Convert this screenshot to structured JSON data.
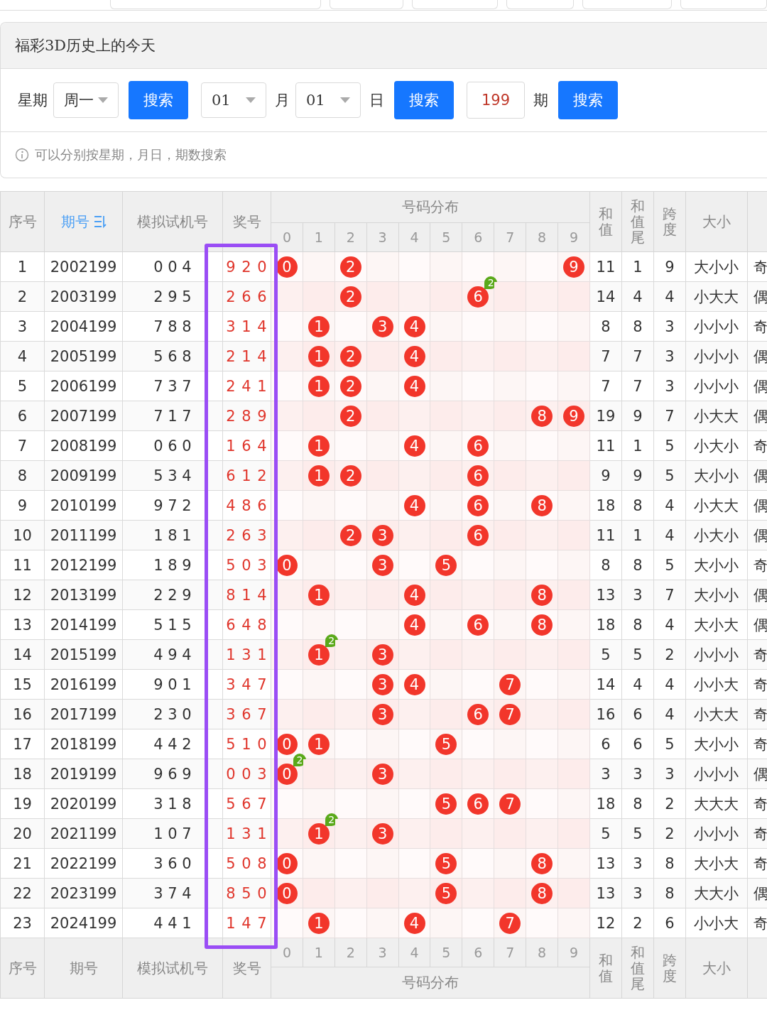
{
  "panel": {
    "title": "福彩3D历史上的今天",
    "controls": [
      {
        "kind": "label",
        "text": "星期"
      },
      {
        "kind": "select",
        "value": "周一"
      },
      {
        "kind": "button",
        "text": "搜索"
      },
      {
        "kind": "select",
        "value": "01"
      },
      {
        "kind": "label",
        "text": "月"
      },
      {
        "kind": "select",
        "value": "01"
      },
      {
        "kind": "label",
        "text": "日"
      },
      {
        "kind": "button",
        "text": "搜索"
      },
      {
        "kind": "input",
        "value": "199"
      },
      {
        "kind": "label",
        "text": "期"
      },
      {
        "kind": "button",
        "text": "搜索"
      }
    ],
    "hint": "可以分别按星期，月日，期数搜索"
  },
  "table": {
    "prize_highlight": true,
    "header": {
      "index": "序号",
      "issue": "期号",
      "issue_sorted": true,
      "trial": "模拟试机号",
      "prize": "奖号",
      "distribution": "号码分布",
      "digits": [
        "0",
        "1",
        "2",
        "3",
        "4",
        "5",
        "6",
        "7",
        "8",
        "9"
      ],
      "sum": "和值",
      "sum_tail": "和值尾",
      "span": "跨度",
      "size": "大小"
    },
    "rows": [
      {
        "index": "1",
        "issue": "2002199",
        "trial": "0 0 4",
        "prize": "9 2 0",
        "cells": [
          {
            "hit": true,
            "ball": "0"
          },
          {
            "hit": false
          },
          {
            "hit": true,
            "ball": "2"
          },
          {
            "hit": false
          },
          {
            "hit": false
          },
          {
            "hit": false
          },
          {
            "hit": false
          },
          {
            "hit": false
          },
          {
            "hit": false
          },
          {
            "hit": true,
            "ball": "9"
          }
        ],
        "sum": "11",
        "sum_tail": "1",
        "span": "9",
        "size": "大小小",
        "column_15": "奇"
      },
      {
        "index": "2",
        "issue": "2003199",
        "trial": "2 9 5",
        "prize": "2 6 6",
        "cells": [
          {
            "hit": false
          },
          {
            "hit": false
          },
          {
            "hit": true,
            "ball": "2"
          },
          {
            "hit": false
          },
          {
            "hit": false
          },
          {
            "hit": false
          },
          {
            "hit": true,
            "ball": "6",
            "repeat": "2"
          },
          {
            "hit": false
          },
          {
            "hit": false
          },
          {
            "hit": false
          }
        ],
        "sum": "14",
        "sum_tail": "4",
        "span": "4",
        "size": "小大大",
        "column_15": "偶"
      },
      {
        "index": "3",
        "issue": "2004199",
        "trial": "7 8 8",
        "prize": "3 1 4",
        "cells": [
          {
            "hit": false
          },
          {
            "hit": true,
            "ball": "1"
          },
          {
            "hit": false
          },
          {
            "hit": true,
            "ball": "3"
          },
          {
            "hit": true,
            "ball": "4"
          },
          {
            "hit": false
          },
          {
            "hit": false
          },
          {
            "hit": false
          },
          {
            "hit": false
          },
          {
            "hit": false
          }
        ],
        "sum": "8",
        "sum_tail": "8",
        "span": "3",
        "size": "小小小",
        "column_15": "奇"
      },
      {
        "index": "4",
        "issue": "2005199",
        "trial": "5 6 8",
        "prize": "2 1 4",
        "cells": [
          {
            "hit": false
          },
          {
            "hit": true,
            "ball": "1"
          },
          {
            "hit": true,
            "ball": "2"
          },
          {
            "hit": false
          },
          {
            "hit": true,
            "ball": "4"
          },
          {
            "hit": false
          },
          {
            "hit": false
          },
          {
            "hit": false
          },
          {
            "hit": false
          },
          {
            "hit": false
          }
        ],
        "sum": "7",
        "sum_tail": "7",
        "span": "3",
        "size": "小小小",
        "column_15": "偶"
      },
      {
        "index": "5",
        "issue": "2006199",
        "trial": "7 3 7",
        "prize": "2 4 1",
        "cells": [
          {
            "hit": false
          },
          {
            "hit": true,
            "ball": "1"
          },
          {
            "hit": true,
            "ball": "2"
          },
          {
            "hit": false
          },
          {
            "hit": true,
            "ball": "4"
          },
          {
            "hit": false
          },
          {
            "hit": false
          },
          {
            "hit": false
          },
          {
            "hit": false
          },
          {
            "hit": false
          }
        ],
        "sum": "7",
        "sum_tail": "7",
        "span": "3",
        "size": "小小小",
        "column_15": "偶"
      },
      {
        "index": "6",
        "issue": "2007199",
        "trial": "7 1 7",
        "prize": "2 8 9",
        "cells": [
          {
            "hit": false
          },
          {
            "hit": false
          },
          {
            "hit": true,
            "ball": "2"
          },
          {
            "hit": false
          },
          {
            "hit": false
          },
          {
            "hit": false
          },
          {
            "hit": false
          },
          {
            "hit": false
          },
          {
            "hit": true,
            "ball": "8"
          },
          {
            "hit": true,
            "ball": "9"
          }
        ],
        "sum": "19",
        "sum_tail": "9",
        "span": "7",
        "size": "小大大",
        "column_15": "偶"
      },
      {
        "index": "7",
        "issue": "2008199",
        "trial": "0 6 0",
        "prize": "1 6 4",
        "cells": [
          {
            "hit": false
          },
          {
            "hit": true,
            "ball": "1"
          },
          {
            "hit": false
          },
          {
            "hit": false
          },
          {
            "hit": true,
            "ball": "4"
          },
          {
            "hit": false
          },
          {
            "hit": true,
            "ball": "6"
          },
          {
            "hit": false
          },
          {
            "hit": false
          },
          {
            "hit": false
          }
        ],
        "sum": "11",
        "sum_tail": "1",
        "span": "5",
        "size": "小大小",
        "column_15": "奇"
      },
      {
        "index": "8",
        "issue": "2009199",
        "trial": "5 3 4",
        "prize": "6 1 2",
        "cells": [
          {
            "hit": false
          },
          {
            "hit": true,
            "ball": "1"
          },
          {
            "hit": true,
            "ball": "2"
          },
          {
            "hit": false
          },
          {
            "hit": false
          },
          {
            "hit": false
          },
          {
            "hit": true,
            "ball": "6"
          },
          {
            "hit": false
          },
          {
            "hit": false
          },
          {
            "hit": false
          }
        ],
        "sum": "9",
        "sum_tail": "9",
        "span": "5",
        "size": "大小小",
        "column_15": "偶"
      },
      {
        "index": "9",
        "issue": "2010199",
        "trial": "9 7 2",
        "prize": "4 8 6",
        "cells": [
          {
            "hit": false
          },
          {
            "hit": false
          },
          {
            "hit": false
          },
          {
            "hit": false
          },
          {
            "hit": true,
            "ball": "4"
          },
          {
            "hit": false
          },
          {
            "hit": true,
            "ball": "6"
          },
          {
            "hit": false
          },
          {
            "hit": true,
            "ball": "8"
          },
          {
            "hit": false
          }
        ],
        "sum": "18",
        "sum_tail": "8",
        "span": "4",
        "size": "小大大",
        "column_15": "偶"
      },
      {
        "index": "10",
        "issue": "2011199",
        "trial": "1 8 1",
        "prize": "2 6 3",
        "cells": [
          {
            "hit": false
          },
          {
            "hit": false
          },
          {
            "hit": true,
            "ball": "2"
          },
          {
            "hit": true,
            "ball": "3"
          },
          {
            "hit": false
          },
          {
            "hit": false
          },
          {
            "hit": true,
            "ball": "6"
          },
          {
            "hit": false
          },
          {
            "hit": false
          },
          {
            "hit": false
          }
        ],
        "sum": "11",
        "sum_tail": "1",
        "span": "4",
        "size": "小大小",
        "column_15": "偶"
      },
      {
        "index": "11",
        "issue": "2012199",
        "trial": "1 8 9",
        "prize": "5 0 3",
        "cells": [
          {
            "hit": true,
            "ball": "0"
          },
          {
            "hit": false
          },
          {
            "hit": false
          },
          {
            "hit": true,
            "ball": "3"
          },
          {
            "hit": false
          },
          {
            "hit": true,
            "ball": "5"
          },
          {
            "hit": false
          },
          {
            "hit": false
          },
          {
            "hit": false
          },
          {
            "hit": false
          }
        ],
        "sum": "8",
        "sum_tail": "8",
        "span": "5",
        "size": "大小小",
        "column_15": "奇"
      },
      {
        "index": "12",
        "issue": "2013199",
        "trial": "2 2 9",
        "prize": "8 1 4",
        "cells": [
          {
            "hit": false
          },
          {
            "hit": true,
            "ball": "1"
          },
          {
            "hit": false
          },
          {
            "hit": false
          },
          {
            "hit": true,
            "ball": "4"
          },
          {
            "hit": false
          },
          {
            "hit": false
          },
          {
            "hit": false
          },
          {
            "hit": true,
            "ball": "8"
          },
          {
            "hit": false
          }
        ],
        "sum": "13",
        "sum_tail": "3",
        "span": "7",
        "size": "大小小",
        "column_15": "偶"
      },
      {
        "index": "13",
        "issue": "2014199",
        "trial": "5 1 5",
        "prize": "6 4 8",
        "cells": [
          {
            "hit": false
          },
          {
            "hit": false
          },
          {
            "hit": false
          },
          {
            "hit": false
          },
          {
            "hit": true,
            "ball": "4"
          },
          {
            "hit": false
          },
          {
            "hit": true,
            "ball": "6"
          },
          {
            "hit": false
          },
          {
            "hit": true,
            "ball": "8"
          },
          {
            "hit": false
          }
        ],
        "sum": "18",
        "sum_tail": "8",
        "span": "4",
        "size": "大小大",
        "column_15": "偶"
      },
      {
        "index": "14",
        "issue": "2015199",
        "trial": "4 9 4",
        "prize": "1 3 1",
        "cells": [
          {
            "hit": false
          },
          {
            "hit": true,
            "ball": "1",
            "repeat": "2"
          },
          {
            "hit": false
          },
          {
            "hit": true,
            "ball": "3"
          },
          {
            "hit": false
          },
          {
            "hit": false
          },
          {
            "hit": false
          },
          {
            "hit": false
          },
          {
            "hit": false
          },
          {
            "hit": false
          }
        ],
        "sum": "5",
        "sum_tail": "5",
        "span": "2",
        "size": "小小小",
        "column_15": "奇"
      },
      {
        "index": "15",
        "issue": "2016199",
        "trial": "9 0 1",
        "prize": "3 4 7",
        "cells": [
          {
            "hit": false
          },
          {
            "hit": false
          },
          {
            "hit": false
          },
          {
            "hit": true,
            "ball": "3"
          },
          {
            "hit": true,
            "ball": "4"
          },
          {
            "hit": false
          },
          {
            "hit": false
          },
          {
            "hit": true,
            "ball": "7"
          },
          {
            "hit": false
          },
          {
            "hit": false
          }
        ],
        "sum": "14",
        "sum_tail": "4",
        "span": "4",
        "size": "小小大",
        "column_15": "奇"
      },
      {
        "index": "16",
        "issue": "2017199",
        "trial": "2 3 0",
        "prize": "3 6 7",
        "cells": [
          {
            "hit": false
          },
          {
            "hit": false
          },
          {
            "hit": false
          },
          {
            "hit": true,
            "ball": "3"
          },
          {
            "hit": false
          },
          {
            "hit": false
          },
          {
            "hit": true,
            "ball": "6"
          },
          {
            "hit": true,
            "ball": "7"
          },
          {
            "hit": false
          },
          {
            "hit": false
          }
        ],
        "sum": "16",
        "sum_tail": "6",
        "span": "4",
        "size": "小大大",
        "column_15": "奇"
      },
      {
        "index": "17",
        "issue": "2018199",
        "trial": "4 4 2",
        "prize": "5 1 0",
        "cells": [
          {
            "hit": true,
            "ball": "0"
          },
          {
            "hit": true,
            "ball": "1"
          },
          {
            "hit": false
          },
          {
            "hit": false
          },
          {
            "hit": false
          },
          {
            "hit": true,
            "ball": "5"
          },
          {
            "hit": false
          },
          {
            "hit": false
          },
          {
            "hit": false
          },
          {
            "hit": false
          }
        ],
        "sum": "6",
        "sum_tail": "6",
        "span": "5",
        "size": "大小小",
        "column_15": "奇"
      },
      {
        "index": "18",
        "issue": "2019199",
        "trial": "9 6 9",
        "prize": "0 0 3",
        "cells": [
          {
            "hit": true,
            "ball": "0",
            "repeat": "2"
          },
          {
            "hit": false
          },
          {
            "hit": false
          },
          {
            "hit": true,
            "ball": "3"
          },
          {
            "hit": false
          },
          {
            "hit": false
          },
          {
            "hit": false
          },
          {
            "hit": false
          },
          {
            "hit": false
          },
          {
            "hit": false
          }
        ],
        "sum": "3",
        "sum_tail": "3",
        "span": "3",
        "size": "小小小",
        "column_15": "偶"
      },
      {
        "index": "19",
        "issue": "2020199",
        "trial": "3 1 8",
        "prize": "5 6 7",
        "cells": [
          {
            "hit": false
          },
          {
            "hit": false
          },
          {
            "hit": false
          },
          {
            "hit": false
          },
          {
            "hit": false
          },
          {
            "hit": true,
            "ball": "5"
          },
          {
            "hit": true,
            "ball": "6"
          },
          {
            "hit": true,
            "ball": "7"
          },
          {
            "hit": false
          },
          {
            "hit": false
          }
        ],
        "sum": "18",
        "sum_tail": "8",
        "span": "2",
        "size": "大大大",
        "column_15": "奇"
      },
      {
        "index": "20",
        "issue": "2021199",
        "trial": "1 0 7",
        "prize": "1 3 1",
        "cells": [
          {
            "hit": false
          },
          {
            "hit": true,
            "ball": "1",
            "repeat": "2"
          },
          {
            "hit": false
          },
          {
            "hit": true,
            "ball": "3"
          },
          {
            "hit": false
          },
          {
            "hit": false
          },
          {
            "hit": false
          },
          {
            "hit": false
          },
          {
            "hit": false
          },
          {
            "hit": false
          }
        ],
        "sum": "5",
        "sum_tail": "5",
        "span": "2",
        "size": "小小小",
        "column_15": "奇"
      },
      {
        "index": "21",
        "issue": "2022199",
        "trial": "3 6 0",
        "prize": "5 0 8",
        "cells": [
          {
            "hit": true,
            "ball": "0"
          },
          {
            "hit": false
          },
          {
            "hit": false
          },
          {
            "hit": false
          },
          {
            "hit": false
          },
          {
            "hit": true,
            "ball": "5"
          },
          {
            "hit": false
          },
          {
            "hit": false
          },
          {
            "hit": true,
            "ball": "8"
          },
          {
            "hit": false
          }
        ],
        "sum": "13",
        "sum_tail": "3",
        "span": "8",
        "size": "大小大",
        "column_15": "奇"
      },
      {
        "index": "22",
        "issue": "2023199",
        "trial": "3 7 4",
        "prize": "8 5 0",
        "cells": [
          {
            "hit": true,
            "ball": "0"
          },
          {
            "hit": false
          },
          {
            "hit": false
          },
          {
            "hit": false
          },
          {
            "hit": false
          },
          {
            "hit": true,
            "ball": "5"
          },
          {
            "hit": false
          },
          {
            "hit": false
          },
          {
            "hit": true,
            "ball": "8"
          },
          {
            "hit": false
          }
        ],
        "sum": "13",
        "sum_tail": "3",
        "span": "8",
        "size": "大大小",
        "column_15": "偶"
      },
      {
        "index": "23",
        "issue": "2024199",
        "trial": "4 4 1",
        "prize": "1 4 7",
        "cells": [
          {
            "hit": false
          },
          {
            "hit": true,
            "ball": "1"
          },
          {
            "hit": false
          },
          {
            "hit": false
          },
          {
            "hit": true,
            "ball": "4"
          },
          {
            "hit": false
          },
          {
            "hit": false
          },
          {
            "hit": true,
            "ball": "7"
          },
          {
            "hit": false
          },
          {
            "hit": false
          }
        ],
        "sum": "12",
        "sum_tail": "2",
        "span": "6",
        "size": "小小大",
        "column_15": "奇"
      }
    ],
    "footer": {
      "index": "序号",
      "issue": "期号",
      "trial": "模拟试机号",
      "prize": "奖号",
      "digits": [
        "0",
        "1",
        "2",
        "3",
        "4",
        "5",
        "6",
        "7",
        "8",
        "9"
      ],
      "distribution": "号码分布",
      "sum": "和值",
      "sum_tail": "和值尾",
      "span": "跨度",
      "size": "大小"
    }
  }
}
